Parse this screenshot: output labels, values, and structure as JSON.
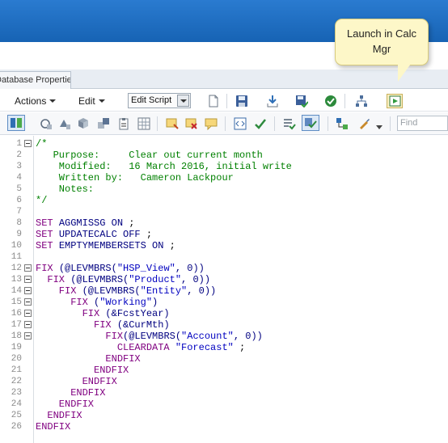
{
  "tab": {
    "label": "Database Properties"
  },
  "toolbar": {
    "actions_label": "Actions",
    "actions_underline": "A",
    "edit_label": "Edit",
    "edit_underline": "E",
    "edit_script_value": "Edit Script",
    "find_placeholder": "Find"
  },
  "tooltip": {
    "text_line1": "Launch in Calc",
    "text_line2": "Mgr"
  },
  "code_lines": [
    {
      "n": "1",
      "fold": true,
      "segments": [
        {
          "t": "/*",
          "c": "comment"
        }
      ]
    },
    {
      "n": "2",
      "fold": false,
      "segments": [
        {
          "t": "   Purpose:     Clear out current month",
          "c": "comment"
        }
      ]
    },
    {
      "n": "3",
      "fold": false,
      "segments": [
        {
          "t": "    Modified:   16 March 2016, initial write",
          "c": "comment"
        }
      ]
    },
    {
      "n": "4",
      "fold": false,
      "segments": [
        {
          "t": "    Written by:   Cameron Lackpour",
          "c": "comment"
        }
      ]
    },
    {
      "n": "5",
      "fold": false,
      "segments": [
        {
          "t": "    Notes:",
          "c": "comment"
        }
      ]
    },
    {
      "n": "6",
      "fold": false,
      "segments": [
        {
          "t": "*/",
          "c": "comment"
        }
      ]
    },
    {
      "n": "7",
      "fold": false,
      "segments": []
    },
    {
      "n": "8",
      "fold": false,
      "segments": [
        {
          "t": "SET ",
          "c": "fix"
        },
        {
          "t": "AGGMISSG ON",
          "c": "kw"
        },
        {
          "t": " ;",
          "c": "txt"
        }
      ]
    },
    {
      "n": "9",
      "fold": false,
      "segments": [
        {
          "t": "SET ",
          "c": "fix"
        },
        {
          "t": "UPDATECALC OFF",
          "c": "kw"
        },
        {
          "t": " ;",
          "c": "txt"
        }
      ]
    },
    {
      "n": "10",
      "fold": false,
      "segments": [
        {
          "t": "SET ",
          "c": "fix"
        },
        {
          "t": "EMPTYMEMBERSETS ON",
          "c": "kw"
        },
        {
          "t": " ;",
          "c": "txt"
        }
      ]
    },
    {
      "n": "11",
      "fold": false,
      "segments": []
    },
    {
      "n": "12",
      "fold": true,
      "segments": [
        {
          "t": "FIX ",
          "c": "fix"
        },
        {
          "t": "(@LEVMBRS(",
          "c": "kw"
        },
        {
          "t": "\"HSP_View\"",
          "c": "str"
        },
        {
          "t": ", 0))",
          "c": "kw"
        }
      ]
    },
    {
      "n": "13",
      "fold": true,
      "segments": [
        {
          "t": "  FIX ",
          "c": "fix"
        },
        {
          "t": "(@LEVMBRS(",
          "c": "kw"
        },
        {
          "t": "\"Product\"",
          "c": "str"
        },
        {
          "t": ", 0))",
          "c": "kw"
        }
      ]
    },
    {
      "n": "14",
      "fold": true,
      "segments": [
        {
          "t": "    FIX ",
          "c": "fix"
        },
        {
          "t": "(@LEVMBRS(",
          "c": "kw"
        },
        {
          "t": "\"Entity\"",
          "c": "str"
        },
        {
          "t": ", 0))",
          "c": "kw"
        }
      ]
    },
    {
      "n": "15",
      "fold": true,
      "segments": [
        {
          "t": "      FIX ",
          "c": "fix"
        },
        {
          "t": "(",
          "c": "kw"
        },
        {
          "t": "\"Working\"",
          "c": "str"
        },
        {
          "t": ")",
          "c": "kw"
        }
      ]
    },
    {
      "n": "16",
      "fold": true,
      "segments": [
        {
          "t": "        FIX ",
          "c": "fix"
        },
        {
          "t": "(&FcstYear)",
          "c": "kw"
        }
      ]
    },
    {
      "n": "17",
      "fold": true,
      "segments": [
        {
          "t": "          FIX ",
          "c": "fix"
        },
        {
          "t": "(&CurMth)",
          "c": "kw"
        }
      ]
    },
    {
      "n": "18",
      "fold": true,
      "segments": [
        {
          "t": "            FIX",
          "c": "fix"
        },
        {
          "t": "(@LEVMBRS(",
          "c": "kw"
        },
        {
          "t": "\"Account\"",
          "c": "str"
        },
        {
          "t": ", 0))",
          "c": "kw"
        }
      ]
    },
    {
      "n": "19",
      "fold": false,
      "segments": [
        {
          "t": "              CLEARDATA ",
          "c": "fix"
        },
        {
          "t": "\"Forecast\"",
          "c": "str"
        },
        {
          "t": " ;",
          "c": "txt"
        }
      ]
    },
    {
      "n": "20",
      "fold": false,
      "segments": [
        {
          "t": "            ENDFIX",
          "c": "fix"
        }
      ]
    },
    {
      "n": "21",
      "fold": false,
      "segments": [
        {
          "t": "          ENDFIX",
          "c": "fix"
        }
      ]
    },
    {
      "n": "22",
      "fold": false,
      "segments": [
        {
          "t": "        ENDFIX",
          "c": "fix"
        }
      ]
    },
    {
      "n": "23",
      "fold": false,
      "segments": [
        {
          "t": "      ENDFIX",
          "c": "fix"
        }
      ]
    },
    {
      "n": "24",
      "fold": false,
      "segments": [
        {
          "t": "    ENDFIX",
          "c": "fix"
        }
      ]
    },
    {
      "n": "25",
      "fold": false,
      "segments": [
        {
          "t": "  ENDFIX",
          "c": "fix"
        }
      ]
    },
    {
      "n": "26",
      "fold": false,
      "segments": [
        {
          "t": "ENDFIX",
          "c": "fix"
        }
      ]
    }
  ],
  "colors": {
    "header_blue": "#1f6fbf",
    "comment": "#008000",
    "keyword": "#000080",
    "fix": "#800080",
    "string": "#0000c0"
  }
}
